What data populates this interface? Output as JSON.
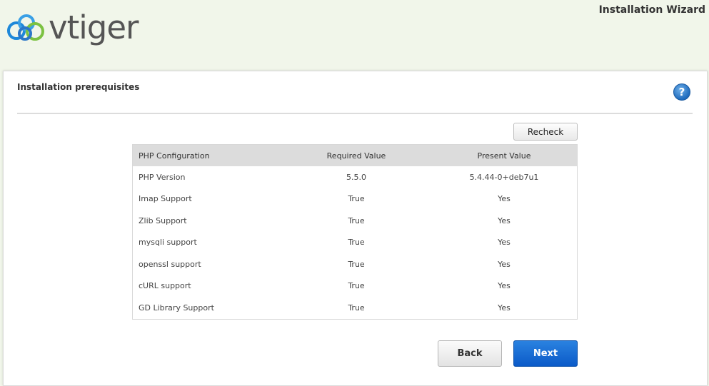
{
  "header": {
    "logo_text": "vtiger",
    "wizard_title": "Installation Wizard"
  },
  "panel": {
    "title": "Installation prerequisites",
    "help_glyph": "?",
    "recheck_label": "Recheck",
    "back_label": "Back",
    "next_label": "Next"
  },
  "table": {
    "columns": [
      "PHP Configuration",
      "Required Value",
      "Present Value"
    ],
    "rows": [
      [
        "PHP Version",
        "5.5.0",
        "5.4.44-0+deb7u1"
      ],
      [
        "Imap Support",
        "True",
        "Yes"
      ],
      [
        "Zlib Support",
        "True",
        "Yes"
      ],
      [
        "mysqli support",
        "True",
        "Yes"
      ],
      [
        "openssl support",
        "True",
        "Yes"
      ],
      [
        "cURL support",
        "True",
        "Yes"
      ],
      [
        "GD Library Support",
        "True",
        "Yes"
      ]
    ]
  },
  "colors": {
    "page_background": "#f1f6ea",
    "next_button": "#0b5ac8",
    "help_icon": "#1f6bbd",
    "logo_blue": "#1e88d9",
    "logo_green": "#7cc242"
  },
  "icons": {
    "logo": "vtiger-cloud-logo-icon",
    "help": "question-circle-icon"
  }
}
